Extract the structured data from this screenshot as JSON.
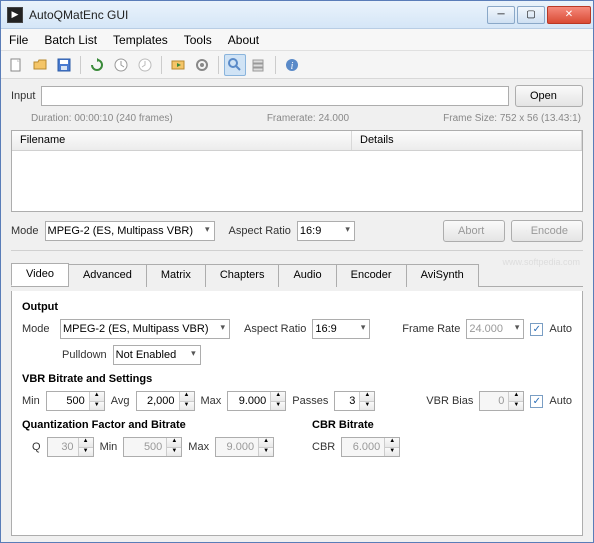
{
  "title": "AutoQMatEnc GUI",
  "menu": [
    "File",
    "Batch List",
    "Templates",
    "Tools",
    "About"
  ],
  "input": {
    "label": "Input",
    "value": "",
    "open_btn": "Open"
  },
  "info": {
    "duration": "Duration: 00:00:10 (240 frames)",
    "framerate": "Framerate: 24.000",
    "framesize": "Frame Size: 752 x 56 (13.43:1)"
  },
  "list": {
    "cols": [
      "Filename",
      "Details"
    ]
  },
  "mode_row": {
    "mode_label": "Mode",
    "mode_value": "MPEG-2 (ES, Multipass VBR)",
    "aspect_label": "Aspect Ratio",
    "aspect_value": "16:9",
    "abort": "Abort",
    "encode": "Encode"
  },
  "tabs": [
    "Video",
    "Advanced",
    "Matrix",
    "Chapters",
    "Audio",
    "Encoder",
    "AviSynth"
  ],
  "output": {
    "title": "Output",
    "mode_label": "Mode",
    "mode_value": "MPEG-2 (ES, Multipass VBR)",
    "aspect_label": "Aspect Ratio",
    "aspect_value": "16:9",
    "framerate_label": "Frame Rate",
    "framerate_value": "24.000",
    "auto_label": "Auto",
    "auto_checked": true,
    "pulldown_label": "Pulldown",
    "pulldown_value": "Not Enabled"
  },
  "vbr": {
    "title": "VBR Bitrate and Settings",
    "min_label": "Min",
    "min_value": "500",
    "avg_label": "Avg",
    "avg_value": "2,000",
    "max_label": "Max",
    "max_value": "9.000",
    "passes_label": "Passes",
    "passes_value": "3",
    "bias_label": "VBR Bias",
    "bias_value": "0",
    "auto_label": "Auto",
    "auto_checked": true
  },
  "qf": {
    "title": "Quantization Factor and Bitrate",
    "q_label": "Q",
    "q_value": "30",
    "min_label": "Min",
    "min_value": "500",
    "max_label": "Max",
    "max_value": "9.000"
  },
  "cbr": {
    "title": "CBR Bitrate",
    "label": "CBR",
    "value": "6.000"
  },
  "watermark": "www.softpedia.com"
}
